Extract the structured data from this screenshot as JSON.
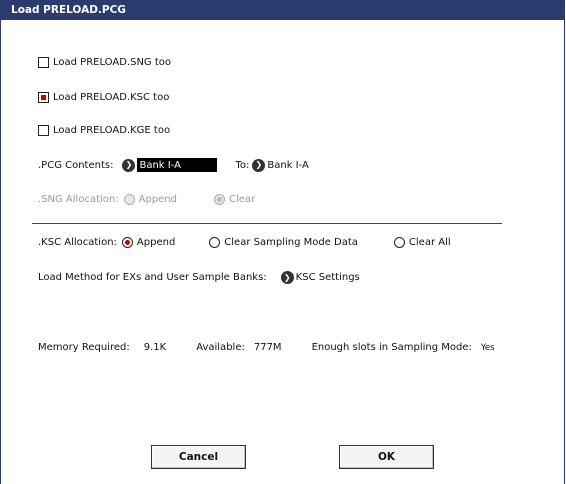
{
  "title": "Load PRELOAD.PCG",
  "options": {
    "load_sng": {
      "label": "Load PRELOAD.SNG too",
      "checked": false
    },
    "load_ksc": {
      "label": "Load PRELOAD.KSC too",
      "checked": true
    },
    "load_kge": {
      "label": "Load PRELOAD.KGE too",
      "checked": false
    }
  },
  "pcg_contents": {
    "label": ".PCG Contents:",
    "value": "Bank I-A",
    "to_label": "To:",
    "to_value": "Bank I-A"
  },
  "sng_allocation": {
    "label": ".SNG Allocation:",
    "append": "Append",
    "clear": "Clear",
    "selected": "Clear",
    "disabled": true
  },
  "ksc_allocation": {
    "label": ".KSC Allocation:",
    "append": "Append",
    "clear_sampling": "Clear Sampling Mode Data",
    "clear_all": "Clear All",
    "selected": "Append"
  },
  "load_method": {
    "label": "Load Method for EXs and User Sample Banks:",
    "button": "KSC Settings"
  },
  "memory": {
    "required_label": "Memory Required:",
    "required_value": "9.1K",
    "available_label": "Available:",
    "available_value": "777M",
    "slots_label": "Enough slots in Sampling Mode:",
    "slots_value": "Yes"
  },
  "buttons": {
    "cancel": "Cancel",
    "ok": "OK"
  },
  "colors": {
    "titlebar": "#2b3b70",
    "accent_red": "#cc0000"
  }
}
